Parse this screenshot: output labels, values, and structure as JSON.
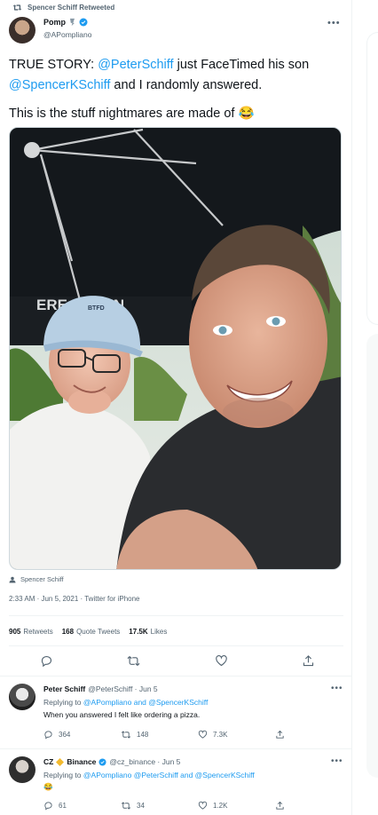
{
  "retweet_banner": {
    "text": "Spencer Schiff Retweeted"
  },
  "tweet": {
    "author_name": "Pomp",
    "author_handle": "@APompliano",
    "text_parts": {
      "p1_a": "TRUE STORY: ",
      "p1_m1": "@PeterSchiff",
      "p1_b": " just FaceTimed his son",
      "p1_m2": "@SpencerKSchiff",
      "p1_c": " and I randomly answered.",
      "p2": "This is the stuff nightmares are made of "
    },
    "photo_cap_text": "BTFD",
    "photo_sign_text": "ERE  JOURN",
    "tagged": "Spencer Schiff",
    "timestamp": "2:33 AM · Jun 5, 2021 · Twitter for iPhone",
    "stats": {
      "retweets_count": "905",
      "retweets_label": "Retweets",
      "quotes_count": "168",
      "quotes_label": "Quote Tweets",
      "likes_count": "17.5K",
      "likes_label": "Likes"
    }
  },
  "replies": [
    {
      "name": "Peter Schiff",
      "handle_time": "@PeterSchiff · Jun 5",
      "replying_prefix": "Replying to ",
      "replying_to": "@APompliano and @SpencerKSchiff",
      "body": "When you answered I felt like ordering a pizza.",
      "replies": "364",
      "retweets": "148",
      "likes": "7.3K"
    },
    {
      "name": "CZ",
      "name_suffix": "Binance",
      "handle_time": "@cz_binance · Jun 5",
      "replying_prefix": "Replying to ",
      "replying_to": "@APompliano @PeterSchiff and @SpencerKSchiff",
      "body": "😂",
      "replies": "61",
      "retweets": "34",
      "likes": "1.2K"
    }
  ],
  "colors": {
    "accent": "#1d9bf0",
    "muted": "#536471",
    "binance": "#f3ba2f",
    "verified": "#1d9bf0"
  },
  "icons": [
    "retweet-icon",
    "verified-badge-icon",
    "more-icon",
    "reply-icon",
    "like-icon",
    "share-icon",
    "tag-person-icon"
  ]
}
